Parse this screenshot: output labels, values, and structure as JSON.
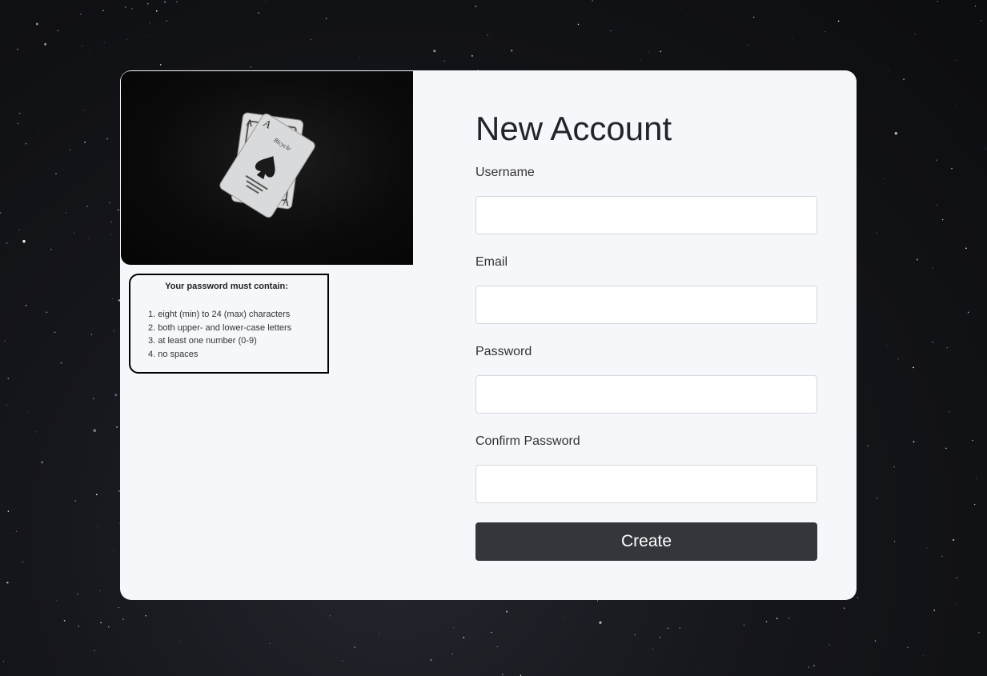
{
  "form": {
    "title": "New Account",
    "fields": [
      {
        "label": "Username",
        "value": "",
        "placeholder": "",
        "type": "text"
      },
      {
        "label": "Email",
        "value": "",
        "placeholder": "",
        "type": "email"
      },
      {
        "label": "Password",
        "value": "",
        "placeholder": "",
        "type": "password"
      },
      {
        "label": "Confirm Password",
        "value": "",
        "placeholder": "",
        "type": "password"
      }
    ],
    "submit_label": "Create"
  },
  "password_rules": {
    "title": "Your password must contain:",
    "items": [
      "1. eight (min) to 24 (max) characters",
      "2. both upper- and lower-case letters",
      "3. at least one number (0-9)",
      "4. no spaces"
    ]
  },
  "hero": {
    "card_text": "Bicycle",
    "card_rank": "A"
  },
  "colors": {
    "card_background": "#f6f7fb",
    "button": "#33363b",
    "page_background": "#15161b"
  }
}
